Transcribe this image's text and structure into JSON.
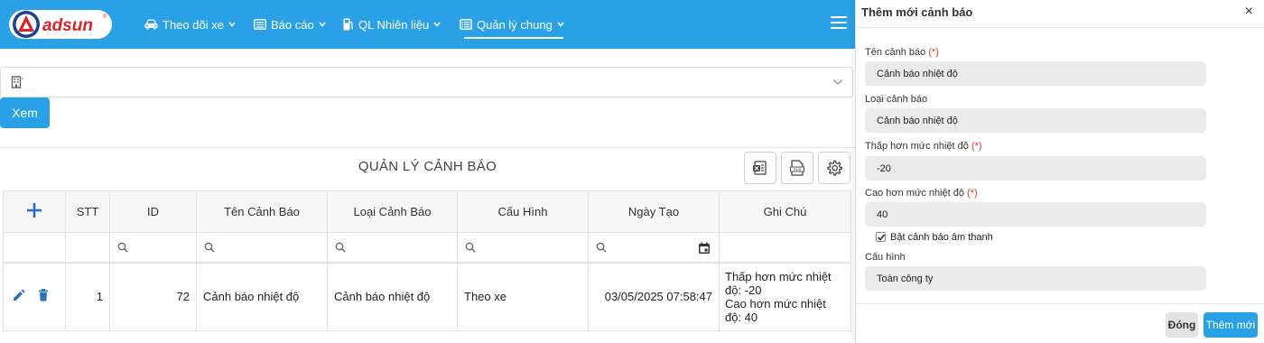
{
  "brand": {
    "logo_text": "adsun"
  },
  "nav": {
    "items": [
      {
        "label": "Theo dõi xe",
        "icon": "car-icon"
      },
      {
        "label": "Báo cáo",
        "icon": "report-icon"
      },
      {
        "label": "QL Nhiên liệu",
        "icon": "fuel-pump-icon"
      },
      {
        "label": "Quản lý chung",
        "icon": "list-icon",
        "active": true
      }
    ]
  },
  "filter": {
    "company_value": "",
    "view_button": "Xem"
  },
  "section": {
    "title": "QUẢN LÝ CẢNH BÁO"
  },
  "table": {
    "columns": [
      "STT",
      "ID",
      "Tên Cảnh Báo",
      "Loại Cảnh Báo",
      "Cấu Hình",
      "Ngày Tạo",
      "Ghi Chú"
    ],
    "rows": [
      {
        "stt": "1",
        "id": "72",
        "name": "Cảnh báo nhiệt độ",
        "type": "Cảnh báo nhiệt độ",
        "config": "Theo xe",
        "created": "03/05/2025 07:58:47",
        "note": "Thấp hơn mức nhiệt độ: -20\nCao hơn mức nhiệt độ: 40"
      }
    ]
  },
  "drawer": {
    "title": "Thêm mới cảnh báo",
    "close_symbol": "×",
    "required_mark": "(*)",
    "fields": {
      "name": {
        "label": "Tên cảnh báo",
        "value": "Cảnh báo nhiệt độ"
      },
      "type": {
        "label": "Loại cảnh báo",
        "value": "Cảnh báo nhiệt độ"
      },
      "low": {
        "label": "Thấp hơn mức nhiệt độ",
        "value": "-20"
      },
      "high": {
        "label": "Cao hơn mức nhiệt độ",
        "value": "40"
      },
      "config": {
        "label": "Cấu hình",
        "value": "Toàn công ty"
      }
    },
    "sound_checkbox": {
      "label": "Bật cảnh báo âm thanh",
      "checked": true
    },
    "buttons": {
      "close": "Đóng",
      "add": "Thêm mới"
    }
  },
  "colors": {
    "primary": "#2aa0e6",
    "required": "#e03131",
    "logo_red": "#d8232a",
    "logo_blue": "#1f3f95"
  }
}
